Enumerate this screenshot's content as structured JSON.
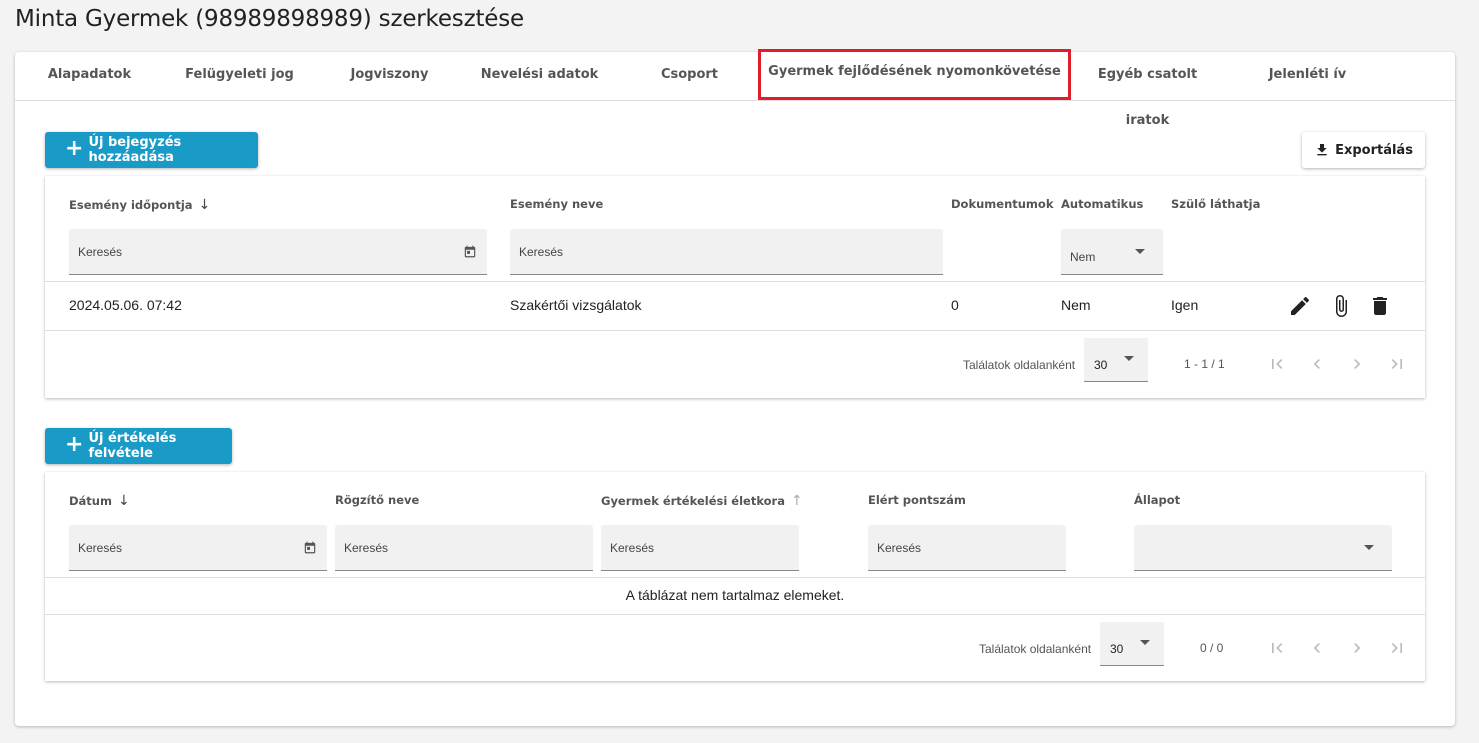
{
  "page": {
    "title": "Minta Gyermek (98989898989) szerkesztése"
  },
  "tabs": [
    {
      "label": "Alapadatok"
    },
    {
      "label": "Felügyeleti jog"
    },
    {
      "label": "Jogviszony"
    },
    {
      "label": "Nevelési adatok"
    },
    {
      "label": "Csoport"
    },
    {
      "label": "Gyermek fejlődésének nyomonkövetése",
      "active": true
    },
    {
      "label": "Egyéb csatolt iratok"
    },
    {
      "label": "Jelenléti ív"
    }
  ],
  "events": {
    "add_button": "Új bejegyzés hozzáadása",
    "export_button": "Exportálás",
    "columns": {
      "date": "Esemény időpontja",
      "name": "Esemény neve",
      "documents": "Dokumentumok",
      "automatic": "Automatikus",
      "parent_visible": "Szülő láthatja"
    },
    "filters": {
      "date_placeholder": "Keresés",
      "name_placeholder": "Keresés",
      "automatic_value": "Nem"
    },
    "rows": [
      {
        "date": "2024.05.06. 07:42",
        "name": "Szakértői vizsgálatok",
        "documents": "0",
        "automatic": "Nem",
        "parent_visible": "Igen"
      }
    ],
    "pagination": {
      "per_page_label": "Találatok oldalanként",
      "per_page": "30",
      "range": "1 - 1 / 1"
    }
  },
  "evaluations": {
    "add_button": "Új értékelés felvétele",
    "columns": {
      "date": "Dátum",
      "recorder": "Rögzítő neve",
      "age": "Gyermek értékelési életkora",
      "score": "Elért pontszám",
      "status": "Állapot"
    },
    "filters": {
      "date_placeholder": "Keresés",
      "recorder_placeholder": "Keresés",
      "age_placeholder": "Keresés",
      "score_placeholder": "Keresés",
      "status_value": ""
    },
    "empty_message": "A táblázat nem tartalmaz elemeket.",
    "pagination": {
      "per_page_label": "Találatok oldalanként",
      "per_page": "30",
      "range": "0 / 0"
    }
  },
  "colors": {
    "accent": "#1a9bc7",
    "highlight": "#e01e2b"
  },
  "icons": [
    "plus-icon",
    "download-icon",
    "calendar-icon",
    "edit-icon",
    "attach-icon",
    "delete-icon",
    "first-page-icon",
    "prev-page-icon",
    "next-page-icon",
    "last-page-icon"
  ]
}
